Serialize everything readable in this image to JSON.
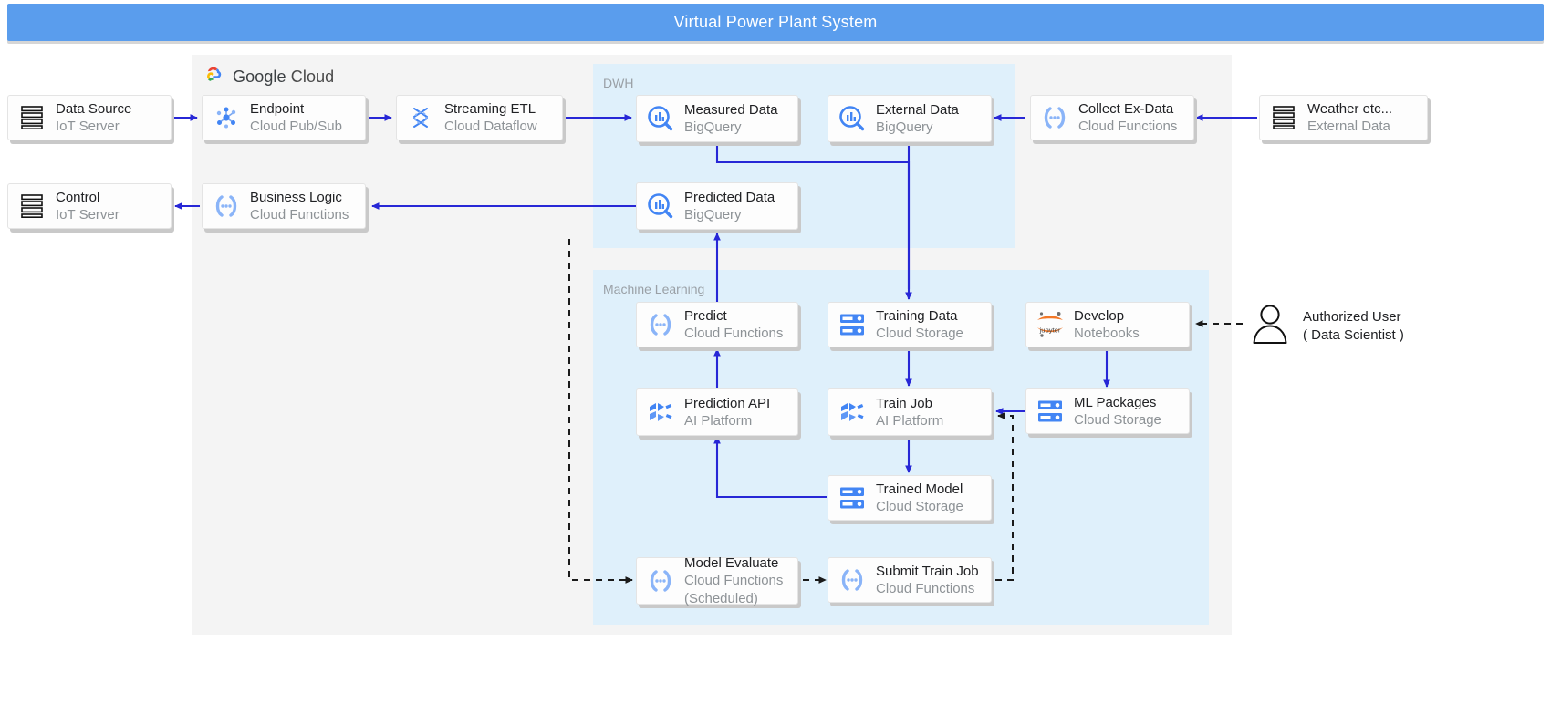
{
  "title": "Virtual Power Plant System",
  "brand": {
    "logo": "google-cloud-logo",
    "name_bold": "Google",
    "name_rest": "Cloud"
  },
  "regions": [
    {
      "key": "gcp",
      "label": ""
    },
    {
      "key": "dwh",
      "label": "DWH"
    },
    {
      "key": "ml",
      "label": "Machine Learning"
    }
  ],
  "colors": {
    "title_bar": "#5a9ded",
    "region_gcp": "#f4f4f4",
    "region_blue": "#dff0fb",
    "arrow_solid": "#2727d6",
    "arrow_dashed": "#1a1a1a",
    "node_bg": "#fdfdfd",
    "label_primary": "#202124",
    "label_secondary": "#8d9296"
  },
  "nodes": [
    {
      "id": "data-source",
      "icon": "server-icon",
      "l1": "Data Source",
      "l2": "IoT Server",
      "l3": ""
    },
    {
      "id": "control",
      "icon": "server-icon",
      "l1": "Control",
      "l2": "IoT Server",
      "l3": ""
    },
    {
      "id": "endpoint",
      "icon": "cloud-pubsub-icon",
      "l1": "Endpoint",
      "l2": "Cloud Pub/Sub",
      "l3": ""
    },
    {
      "id": "streaming-etl",
      "icon": "cloud-dataflow-icon",
      "l1": "Streaming ETL",
      "l2": "Cloud Dataflow",
      "l3": ""
    },
    {
      "id": "business-logic",
      "icon": "cloud-functions-icon",
      "l1": "Business Logic",
      "l2": "Cloud Functions",
      "l3": ""
    },
    {
      "id": "measured-data",
      "icon": "bigquery-icon",
      "l1": "Measured Data",
      "l2": "BigQuery",
      "l3": ""
    },
    {
      "id": "external-data",
      "icon": "bigquery-icon",
      "l1": "External Data",
      "l2": "BigQuery",
      "l3": ""
    },
    {
      "id": "predicted-data",
      "icon": "bigquery-icon",
      "l1": "Predicted Data",
      "l2": "BigQuery",
      "l3": ""
    },
    {
      "id": "collect-ex-data",
      "icon": "cloud-functions-icon",
      "l1": "Collect Ex-Data",
      "l2": "Cloud Functions",
      "l3": ""
    },
    {
      "id": "weather",
      "icon": "server-icon",
      "l1": "Weather etc...",
      "l2": "External Data",
      "l3": ""
    },
    {
      "id": "predict",
      "icon": "cloud-functions-icon",
      "l1": "Predict",
      "l2": "Cloud Functions",
      "l3": ""
    },
    {
      "id": "training-data",
      "icon": "cloud-storage-icon",
      "l1": "Training Data",
      "l2": "Cloud Storage",
      "l3": ""
    },
    {
      "id": "develop",
      "icon": "jupyter-icon",
      "l1": "Develop",
      "l2": "Notebooks",
      "l3": ""
    },
    {
      "id": "prediction-api",
      "icon": "ai-platform-icon",
      "l1": "Prediction API",
      "l2": "AI Platform",
      "l3": ""
    },
    {
      "id": "train-job",
      "icon": "ai-platform-icon",
      "l1": "Train Job",
      "l2": "AI Platform",
      "l3": ""
    },
    {
      "id": "ml-packages",
      "icon": "cloud-storage-icon",
      "l1": "ML Packages",
      "l2": "Cloud Storage",
      "l3": ""
    },
    {
      "id": "trained-model",
      "icon": "cloud-storage-icon",
      "l1": "Trained Model",
      "l2": "Cloud Storage",
      "l3": ""
    },
    {
      "id": "model-evaluate",
      "icon": "cloud-functions-icon",
      "l1": "Model Evaluate",
      "l2": "Cloud Functions",
      "l3": "(Scheduled)"
    },
    {
      "id": "submit-train-job",
      "icon": "cloud-functions-icon",
      "l1": "Submit Train Job",
      "l2": "Cloud Functions",
      "l3": ""
    }
  ],
  "actor": {
    "icon": "person-icon",
    "a1": "Authorized User",
    "a2": "( Data Scientist )"
  },
  "edges": [
    {
      "from": "data-source",
      "to": "endpoint",
      "style": "solid"
    },
    {
      "from": "endpoint",
      "to": "streaming-etl",
      "style": "solid"
    },
    {
      "from": "streaming-etl",
      "to": "measured-data",
      "style": "solid"
    },
    {
      "from": "weather",
      "to": "collect-ex-data",
      "style": "solid"
    },
    {
      "from": "collect-ex-data",
      "to": "external-data",
      "style": "solid"
    },
    {
      "from": "measured-data",
      "to": "predicted-data",
      "style": "solid"
    },
    {
      "from": "predicted-data",
      "to": "business-logic",
      "style": "solid"
    },
    {
      "from": "business-logic",
      "to": "control",
      "style": "solid"
    },
    {
      "from": "external-data",
      "to": "training-data",
      "style": "solid"
    },
    {
      "from": "training-data",
      "to": "train-job",
      "style": "solid"
    },
    {
      "from": "predict",
      "to": "predicted-data",
      "style": "solid"
    },
    {
      "from": "prediction-api",
      "to": "predict",
      "style": "solid"
    },
    {
      "from": "train-job",
      "to": "trained-model",
      "style": "solid"
    },
    {
      "from": "trained-model",
      "to": "prediction-api",
      "style": "solid"
    },
    {
      "from": "ml-packages",
      "to": "train-job",
      "style": "solid"
    },
    {
      "from": "develop",
      "to": "ml-packages",
      "style": "solid"
    },
    {
      "from": "actor",
      "to": "develop",
      "style": "dashed"
    },
    {
      "from": "predicted-data",
      "to": "model-evaluate",
      "style": "dashed"
    },
    {
      "from": "model-evaluate",
      "to": "submit-train-job",
      "style": "dashed"
    },
    {
      "from": "submit-train-job",
      "to": "train-job",
      "style": "dashed"
    }
  ]
}
